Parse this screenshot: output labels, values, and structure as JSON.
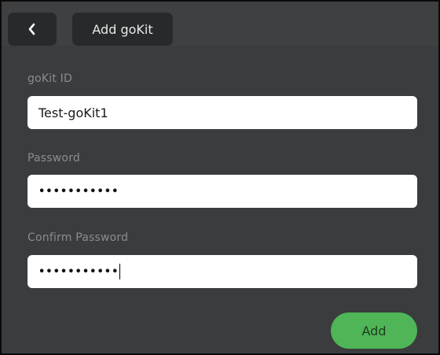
{
  "header": {
    "back_icon": "chevron-left-icon",
    "title": "Add goKit"
  },
  "form": {
    "gokit_id": {
      "label": "goKit ID",
      "value": "Test-goKit1"
    },
    "password": {
      "label": "Password",
      "masked_value": "•••••••••••"
    },
    "confirm_password": {
      "label": "Confirm Password",
      "masked_value": "•••••••••••"
    }
  },
  "actions": {
    "add_label": "Add"
  },
  "colors": {
    "background": "#3a3c3e",
    "pill": "#27292a",
    "accent_green": "#4fb556",
    "label_text": "#8a8c8e"
  }
}
